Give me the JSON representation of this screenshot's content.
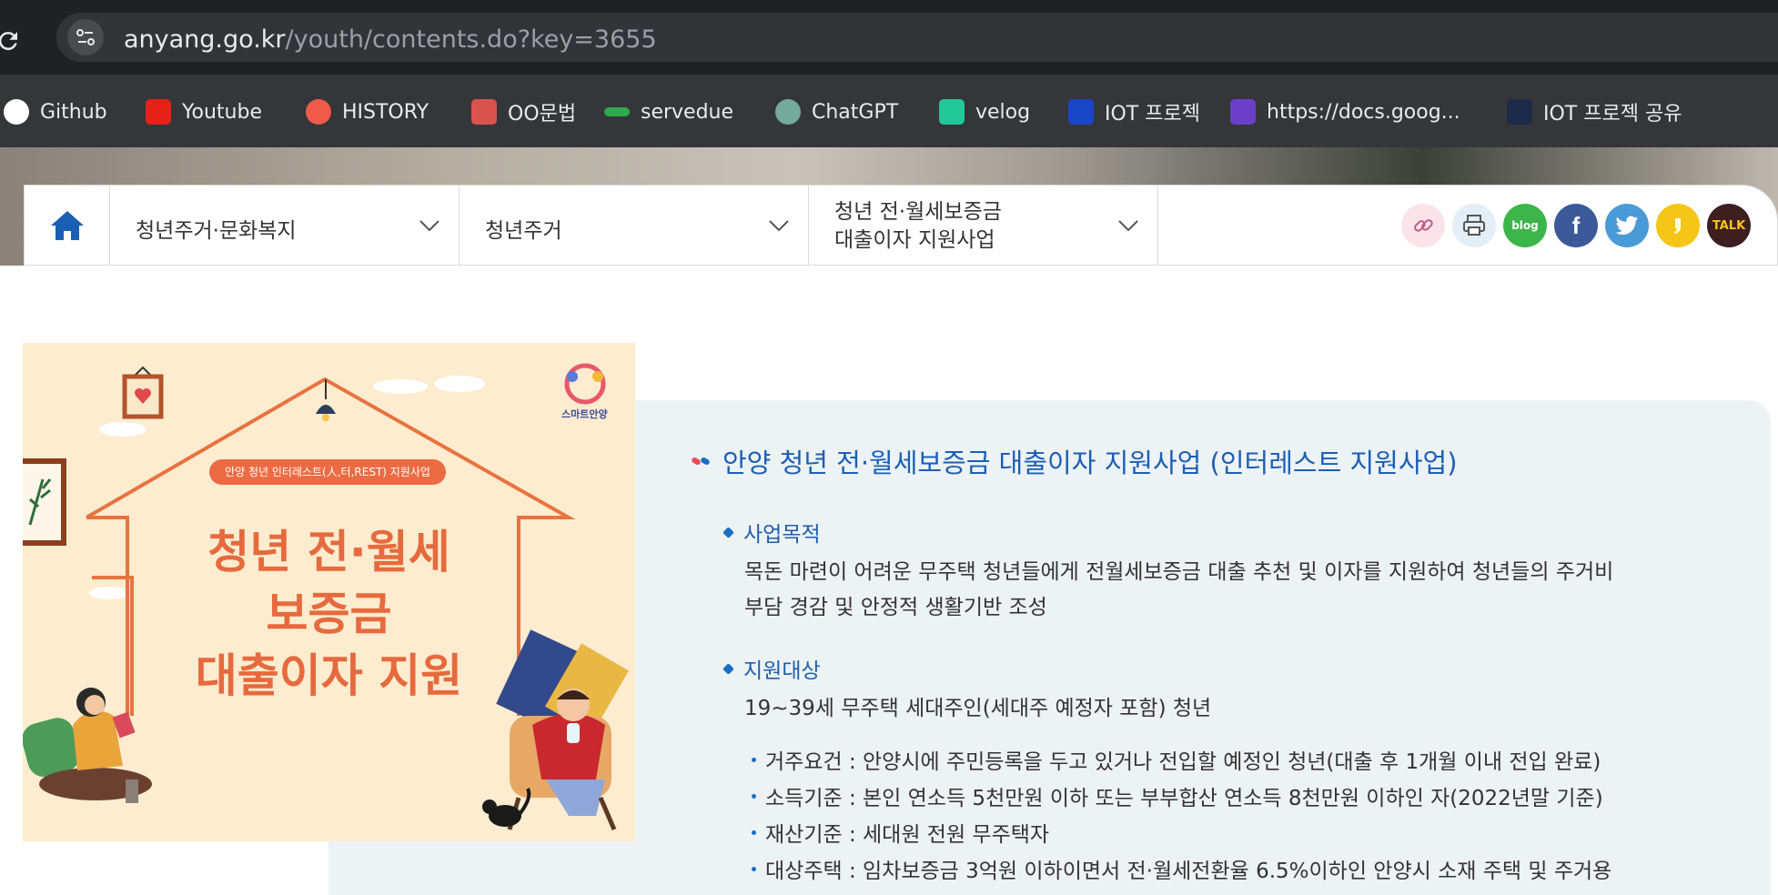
{
  "browser": {
    "url_host": "anyang.go.kr",
    "url_path": "/youth/contents.do?key=3655",
    "bookmarks": [
      {
        "label": "Github"
      },
      {
        "label": "Youtube"
      },
      {
        "label": "HISTORY"
      },
      {
        "label": "OO문법"
      },
      {
        "label": "servedue"
      },
      {
        "label": "ChatGPT"
      },
      {
        "label": "velog"
      },
      {
        "label": "IOT 프로젝"
      },
      {
        "label": "https://docs.goog..."
      },
      {
        "label": "IOT 프로젝 공유"
      }
    ]
  },
  "nav": {
    "dropdowns": [
      {
        "label": "청년주거·문화복지"
      },
      {
        "label": "청년주거"
      },
      {
        "label_line1": "청년 전·월세보증금",
        "label_line2": "대출이자 지원사업"
      }
    ],
    "share_icons": [
      "link-icon",
      "print-icon",
      "blog-icon",
      "facebook-icon",
      "twitter-icon",
      "kakaostory-icon",
      "kakaotalk-icon"
    ],
    "blog_label": "blog",
    "talk_label": "TALK"
  },
  "poster": {
    "banner": "안양 청년 인터레스트(人,터,REST) 지원사업",
    "title_line1": "청년 전·월세",
    "title_line2": "보증금",
    "title_line3": "대출이자 지원",
    "logo_text": "스마트안양"
  },
  "content": {
    "title": "안양 청년 전·월세보증금 대출이자 지원사업 (인터레스트 지원사업)",
    "sections": [
      {
        "heading": "사업목적",
        "paragraph_line1": "목돈 마련이 어려운 무주택 청년들에게 전월세보증금 대출 추천 및 이자를 지원하여 청년들의 주거비",
        "paragraph_line2": "부담 경감 및 안정적 생활기반 조성"
      },
      {
        "heading": "지원대상",
        "paragraph_line1": "19~39세 무주택 세대주인(세대주 예정자 포함) 청년",
        "bullets": [
          "거주요건 : 안양시에 주민등록을 두고 있거나 전입할 예정인 청년(대출 후 1개월 이내 전입 완료)",
          "소득기준 : 본인 연소득 5천만원 이하 또는 부부합산 연소득 8천만원 이하인 자(2022년말 기준)",
          "재산기준 : 세대원 전원 무주택자",
          "대상주택 : 임차보증금 3억원 이하이면서 전·월세전환율 6.5%이하인 안양시 소재 주택 및 주거용"
        ]
      }
    ]
  },
  "colors": {
    "chrome_bg": "#202124",
    "bookmarks_bg": "#35363a",
    "accent_blue": "#1a5fb4",
    "poster_orange": "#e66a3d",
    "panel_bg": "#edf2f5"
  }
}
